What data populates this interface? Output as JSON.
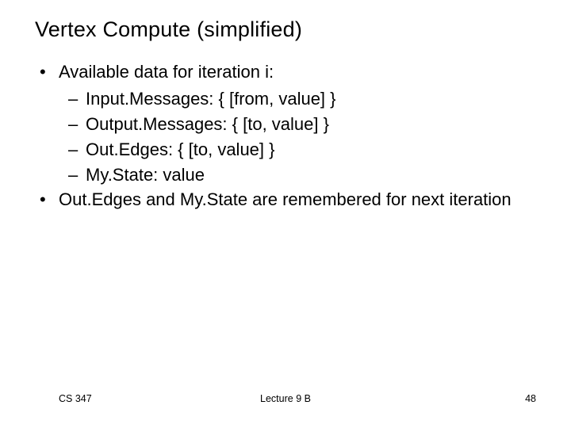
{
  "title": "Vertex Compute (simplified)",
  "bullets": {
    "b1a": "Available data for iteration i:",
    "b2a": "Input.Messages: { [from, value] }",
    "b2b": "Output.Messages: { [to, value] }",
    "b2c": "Out.Edges: { [to, value] }",
    "b2d": "My.State: value",
    "b1b": "Out.Edges and My.State are remembered for next iteration"
  },
  "footer": {
    "left": "CS 347",
    "center": "Lecture 9 B",
    "right": "48"
  },
  "glyph": {
    "bullet": "•",
    "dash": "–"
  }
}
